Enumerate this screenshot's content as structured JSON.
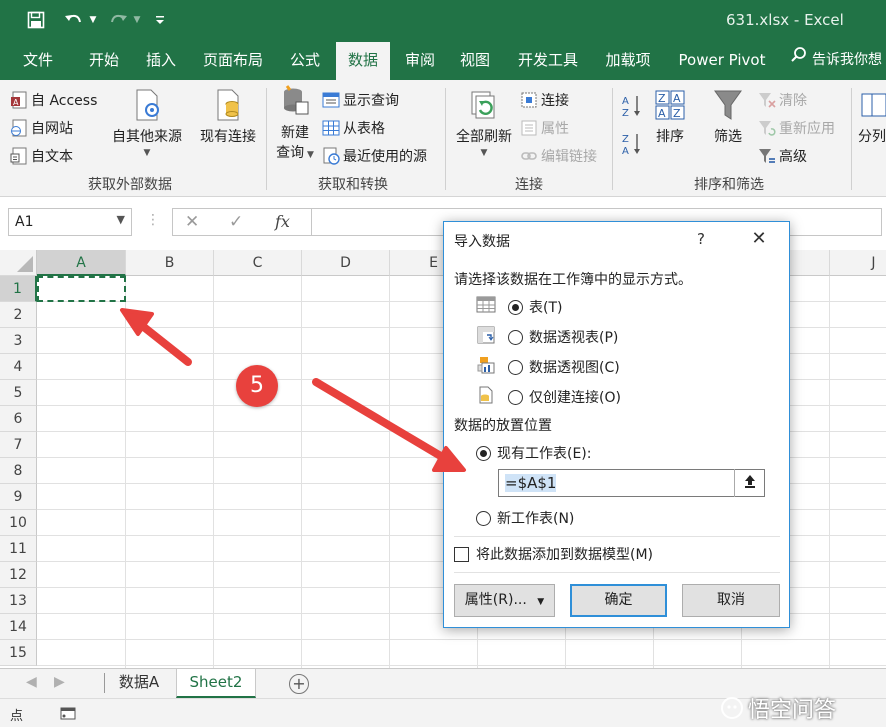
{
  "window": {
    "title": "631.xlsx  -  Excel",
    "quick_access": [
      "save-icon",
      "undo-icon",
      "redo-icon",
      "customize-icon"
    ]
  },
  "tabs": [
    {
      "label": "文件",
      "active": false
    },
    {
      "label": "开始",
      "active": false
    },
    {
      "label": "插入",
      "active": false
    },
    {
      "label": "页面布局",
      "active": false
    },
    {
      "label": "公式",
      "active": false
    },
    {
      "label": "数据",
      "active": true
    },
    {
      "label": "审阅",
      "active": false
    },
    {
      "label": "视图",
      "active": false
    },
    {
      "label": "开发工具",
      "active": false
    },
    {
      "label": "加载项",
      "active": false
    },
    {
      "label": "Power Pivot",
      "active": false
    }
  ],
  "tellme": "告诉我你想",
  "ribbon": {
    "get_external": {
      "label": "获取外部数据",
      "access": "自 Access",
      "web": "自网站",
      "text": "自文本",
      "other_sources": "自其他来源",
      "existing_conn": "现有连接"
    },
    "get_transform": {
      "label": "获取和转换",
      "new_query_line1": "新建",
      "new_query_line2": "查询",
      "show_queries": "显示查询",
      "from_table": "从表格",
      "recent_sources": "最近使用的源"
    },
    "connections": {
      "label": "连接",
      "refresh_all": "全部刷新",
      "connections": "连接",
      "properties": "属性",
      "edit_links": "编辑链接"
    },
    "sort_filter": {
      "label": "排序和筛选",
      "sort": "排序",
      "filter": "筛选",
      "clear": "清除",
      "reapply": "重新应用",
      "advanced": "高级",
      "split": "分列"
    }
  },
  "formula_bar": {
    "name_box": "A1",
    "fx": "fx",
    "value": ""
  },
  "grid": {
    "columns": [
      "A",
      "B",
      "C",
      "D",
      "E",
      "J"
    ],
    "rows": [
      "1",
      "2",
      "3",
      "4",
      "5",
      "6",
      "7",
      "8",
      "9",
      "10",
      "11",
      "12",
      "13",
      "14",
      "15"
    ],
    "selected_cell": "A1"
  },
  "sheets": [
    {
      "name": "数据A",
      "active": false
    },
    {
      "name": "Sheet2",
      "active": true
    }
  ],
  "status": {
    "mode": "点"
  },
  "watermark": "悟空问答",
  "annotation": {
    "step": "5",
    "arrow_color": "#e8413d"
  },
  "dialog": {
    "title": "导入数据",
    "help": "?",
    "close": "✕",
    "prompt": "请选择该数据在工作簿中的显示方式。",
    "view_options": [
      {
        "label": "表(T)",
        "selected": true,
        "icon": "table-icon"
      },
      {
        "label": "数据透视表(P)",
        "selected": false,
        "icon": "pivot-table-icon"
      },
      {
        "label": "数据透视图(C)",
        "selected": false,
        "icon": "pivot-chart-icon"
      },
      {
        "label": "仅创建连接(O)",
        "selected": false,
        "icon": "connection-only-icon"
      }
    ],
    "placement_label": "数据的放置位置",
    "existing_sheet": {
      "label": "现有工作表(E):",
      "selected": true
    },
    "reference": "=$A$1",
    "new_sheet": {
      "label": "新工作表(N)",
      "selected": false
    },
    "add_to_model": {
      "label": "将此数据添加到数据模型(M)",
      "checked": false
    },
    "buttons": {
      "properties": "属性(R)...",
      "ok": "确定",
      "cancel": "取消"
    }
  }
}
